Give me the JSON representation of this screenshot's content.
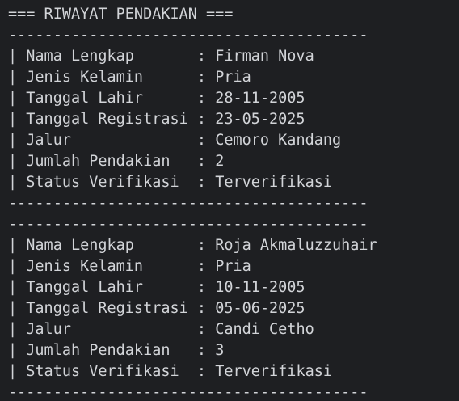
{
  "header": "=== RIWAYAT PENDAKIAN ===",
  "separator": "----------------------------------------",
  "bar": "|",
  "colon": ":",
  "labels": {
    "nama": "Nama Lengkap",
    "jenis_kelamin": "Jenis Kelamin",
    "tanggal_lahir": "Tanggal Lahir",
    "tanggal_registrasi": "Tanggal Registrasi",
    "jalur": "Jalur",
    "jumlah_pendakian": "Jumlah Pendakian",
    "status_verifikasi": "Status Verifikasi"
  },
  "records": [
    {
      "nama": "Firman Nova",
      "jenis_kelamin": "Pria",
      "tanggal_lahir": "28-11-2005",
      "tanggal_registrasi": "23-05-2025",
      "jalur": "Cemoro Kandang",
      "jumlah_pendakian": "2",
      "status_verifikasi": "Terverifikasi"
    },
    {
      "nama": "Roja Akmaluzzuhair",
      "jenis_kelamin": "Pria",
      "tanggal_lahir": "10-11-2005",
      "tanggal_registrasi": "05-06-2025",
      "jalur": "Candi Cetho",
      "jumlah_pendakian": "3",
      "status_verifikasi": "Terverifikasi"
    }
  ],
  "colors": {
    "background": "#1e1f22",
    "text": "#d2d4d8"
  }
}
